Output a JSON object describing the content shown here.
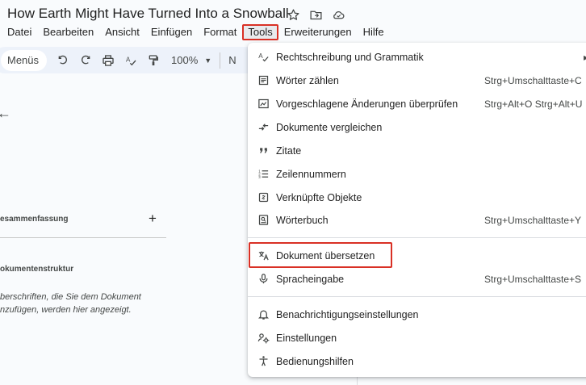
{
  "document": {
    "title": "How Earth Might Have Turned Into a Snowball"
  },
  "title_icons": [
    "star-icon",
    "move-to-folder-icon",
    "cloud-saved-icon"
  ],
  "menubar": {
    "items": [
      "Datei",
      "Bearbeiten",
      "Ansicht",
      "Einfügen",
      "Format",
      "Tools",
      "Erweiterungen",
      "Hilfe"
    ]
  },
  "toolbar": {
    "menus_label": "Menüs",
    "zoom": "100%",
    "truncated_label": "N"
  },
  "left_panel": {
    "summary_label": "esammenfassung",
    "plus": "+",
    "outline_label": "okumentenstruktur",
    "hint_line1": "berschriften, die Sie dem Dokument",
    "hint_line2": "nzufügen, werden hier angezeigt.",
    "back_arrow": "←"
  },
  "tools_menu": {
    "items": [
      {
        "label": "Rechtschreibung und Grammatik",
        "shortcut": "",
        "icon": "spellcheck-icon"
      },
      {
        "label": "Wörter zählen",
        "shortcut": "Strg+Umschalttaste+C",
        "icon": "word-count-icon"
      },
      {
        "label": "Vorgeschlagene Änderungen überprüfen",
        "shortcut": "Strg+Alt+O Strg+Alt+U",
        "icon": "review-edits-icon"
      },
      {
        "label": "Dokumente vergleichen",
        "shortcut": "",
        "icon": "compare-icon"
      },
      {
        "label": "Zitate",
        "shortcut": "",
        "icon": "quote-icon"
      },
      {
        "label": "Zeilennummern",
        "shortcut": "",
        "icon": "line-numbers-icon"
      },
      {
        "label": "Verknüpfte Objekte",
        "shortcut": "",
        "icon": "linked-objects-icon"
      },
      {
        "label": "Wörterbuch",
        "shortcut": "Strg+Umschalttaste+Y",
        "icon": "dictionary-icon"
      },
      {
        "label": "Dokument übersetzen",
        "shortcut": "",
        "icon": "translate-icon"
      },
      {
        "label": "Spracheingabe",
        "shortcut": "Strg+Umschalttaste+S",
        "icon": "microphone-icon"
      },
      {
        "label": "Benachrichtigungseinstellungen",
        "shortcut": "",
        "icon": "bell-icon"
      },
      {
        "label": "Einstellungen",
        "shortcut": "",
        "icon": "settings-icon"
      },
      {
        "label": "Bedienungshilfen",
        "shortcut": "",
        "icon": "accessibility-icon"
      }
    ]
  },
  "colors": {
    "highlight": "#d93025",
    "toolbar_bg": "#edf2fa",
    "page_bg": "#f9fbfd"
  }
}
